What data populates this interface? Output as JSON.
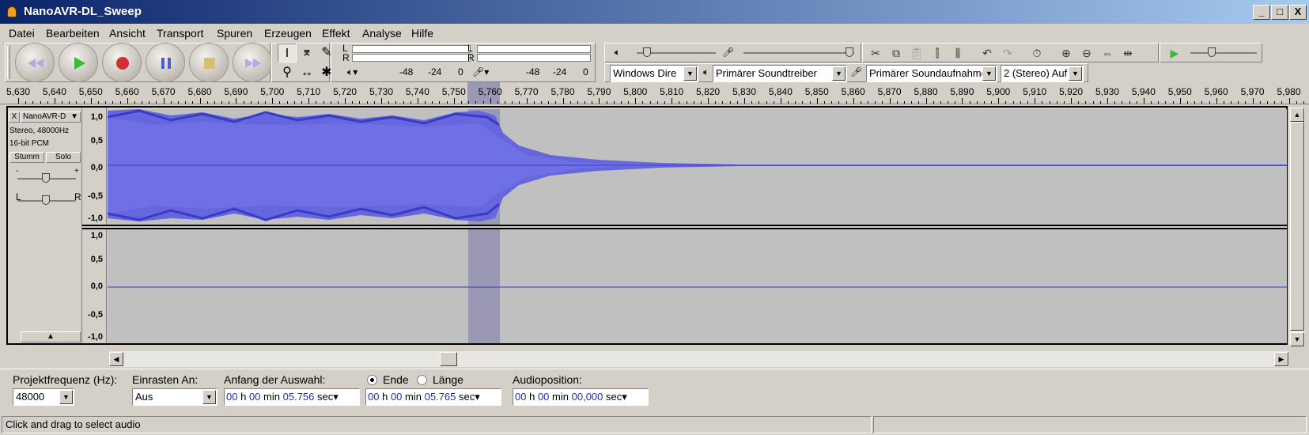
{
  "window": {
    "title": "NanoAVR-DL_Sweep",
    "minimize": "_",
    "maximize": "□",
    "close": "X"
  },
  "menu": [
    "Datei",
    "Bearbeiten",
    "Ansicht",
    "Transport",
    "Spuren",
    "Erzeugen",
    "Effekt",
    "Analyse",
    "Hilfe"
  ],
  "meters": {
    "lr_top": "L",
    "lr_bottom": "R",
    "play_scale": [
      "-48",
      "-24",
      "0"
    ],
    "rec_scale": [
      "-48",
      "-24",
      "0"
    ]
  },
  "devices": {
    "host": "Windows Dire",
    "output": "Primärer Soundtreiber",
    "input": "Primärer Soundaufnahme",
    "channels": "2 (Stereo) Auf"
  },
  "ruler": {
    "ticks": [
      "5,630",
      "5,640",
      "5,650",
      "5,660",
      "5,670",
      "5,680",
      "5,690",
      "5,700",
      "5,710",
      "5,720",
      "5,730",
      "5,740",
      "5,750",
      "5,760",
      "5,770",
      "5,780",
      "5,790",
      "5,800",
      "5,810",
      "5,820",
      "5,830",
      "5,840",
      "5,850",
      "5,860",
      "5,870",
      "5,880",
      "5,890",
      "5,900",
      "5,910",
      "5,920",
      "5,930",
      "5,940",
      "5,950",
      "5,960",
      "5,970",
      "5,980"
    ]
  },
  "track": {
    "name": "NanoAVR-D",
    "close": "X",
    "info_rate": "Stereo, 48000Hz",
    "info_format": "16-bit PCM",
    "mute": "Stumm",
    "solo": "Solo",
    "gain_minus": "-",
    "gain_plus": "+",
    "pan_left": "L",
    "pan_right": "R",
    "scale_top": [
      "1,0",
      "0,5",
      "0,0",
      "-0,5",
      "-1,0"
    ],
    "scale_bottom": [
      "1,0",
      "0,5",
      "0,0",
      "-0,5",
      "-1,0"
    ],
    "wave_color": "#6666dd"
  },
  "selectionbar": {
    "rate_label": "Projektfrequenz (Hz):",
    "rate_value": "48000",
    "snap_label": "Einrasten An:",
    "snap_value": "Aus",
    "start_label": "Anfang der Auswahl:",
    "start": {
      "h": "00",
      "hu": "h",
      "m": "00",
      "mu": "min",
      "s": "05.756",
      "su": "sec"
    },
    "end_label": "Ende",
    "length_label": "Länge",
    "end": {
      "h": "00",
      "hu": "h",
      "m": "00",
      "mu": "min",
      "s": "05.765",
      "su": "sec"
    },
    "audio_label": "Audioposition:",
    "audio": {
      "h": "00",
      "hu": "h",
      "m": "00",
      "mu": "min",
      "s": "00,000",
      "su": "sec"
    }
  },
  "status": "Click and drag to select audio"
}
